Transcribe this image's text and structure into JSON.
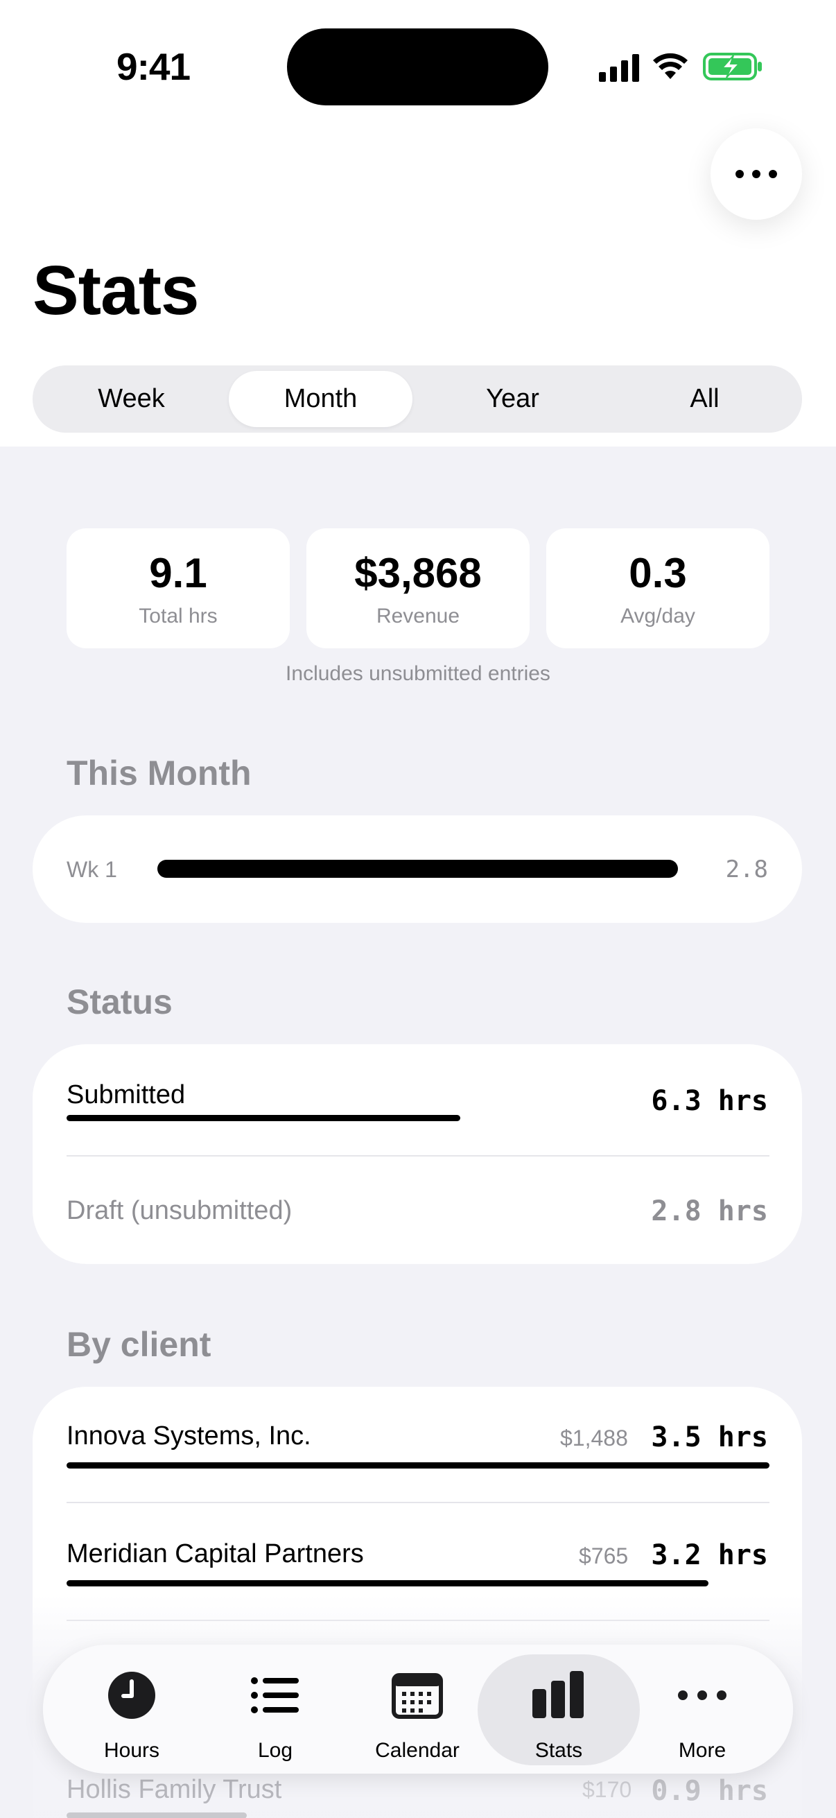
{
  "status_bar": {
    "time": "9:41"
  },
  "header": {
    "title": "Stats"
  },
  "period_tabs": [
    {
      "label": "Week",
      "selected": false
    },
    {
      "label": "Month",
      "selected": true
    },
    {
      "label": "Year",
      "selected": false
    },
    {
      "label": "All",
      "selected": false
    }
  ],
  "summary": [
    {
      "value": "9.1",
      "label": "Total hrs"
    },
    {
      "value": "$3,868",
      "label": "Revenue"
    },
    {
      "value": "0.3",
      "label": "Avg/day"
    }
  ],
  "summary_note": "Includes unsubmitted entries",
  "this_month": {
    "title": "This Month",
    "weeks": [
      {
        "label": "Wk 1",
        "value": "2.8",
        "fraction": 1.0
      }
    ]
  },
  "status": {
    "title": "Status",
    "rows": [
      {
        "label": "Submitted",
        "value": "6.3 hrs",
        "fraction": 0.6
      },
      {
        "label": "Draft (unsubmitted)",
        "value": "2.8 hrs"
      }
    ]
  },
  "by_client": {
    "title": "By client",
    "rows": [
      {
        "name": "Innova Systems, Inc.",
        "amount": "$1,488",
        "value": "3.5 hrs",
        "fraction": 1.0
      },
      {
        "name": "Meridian Capital Partners",
        "amount": "$765",
        "value": "3.2 hrs",
        "fraction": 0.91
      },
      {
        "name": "Hollis Family Trust",
        "amount": "$170",
        "value": "0.9 hrs",
        "fraction": 0.26
      }
    ]
  },
  "tab_bar": {
    "items": [
      {
        "label": "Hours",
        "icon": "clock-icon"
      },
      {
        "label": "Log",
        "icon": "list-icon"
      },
      {
        "label": "Calendar",
        "icon": "calendar-icon"
      },
      {
        "label": "Stats",
        "icon": "bar-chart-icon",
        "active": true
      },
      {
        "label": "More",
        "icon": "ellipsis-icon"
      }
    ]
  },
  "colors": {
    "accent": "#000000",
    "background": "#f2f2f7",
    "secondary_text": "#8e8e93",
    "battery": "#34c759"
  }
}
